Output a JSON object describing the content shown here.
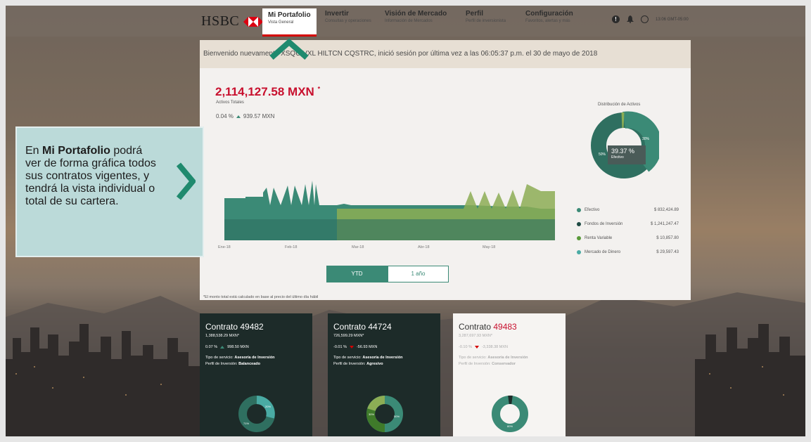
{
  "nav": {
    "logo": "HSBC",
    "items": [
      {
        "title": "Mi Portafolio",
        "sub": "Vista General"
      },
      {
        "title": "Invertir",
        "sub": "Consultas y operaciones"
      },
      {
        "title": "Visión de Mercado",
        "sub": "Información de Mercados"
      },
      {
        "title": "Perfil",
        "sub": "Perfil de inversionista"
      },
      {
        "title": "Configuración",
        "sub": "Favoritos, alertas y más"
      }
    ],
    "time": "13:06 GMT-05:00"
  },
  "welcome": "Bienvenido nuevamente XSQUIVXL HILTCN CQSTRC, inició sesión por última vez a las 06:05:37 p.m. el 30 de mayo de 2018",
  "summary": {
    "total": "2,114,127.58 MXN",
    "total_mark": "*",
    "total_label": "Activos Totales",
    "change_pct": "0.04 %",
    "change_amt": "939.57 MXN"
  },
  "chart_data": {
    "type": "area",
    "x_ticks": [
      "Ene-18",
      "Feb-18",
      "Mar-18",
      "Abr-18",
      "May-18"
    ]
  },
  "distribution": {
    "title": "Distribución de Activos",
    "tooltip_value": "39.37 %",
    "tooltip_label": "Efectivo",
    "slice_labels": [
      "30%",
      "50%"
    ],
    "legend": [
      {
        "name": "Efectivo",
        "amount": "$ 832,424.89",
        "color": "#3b8a76"
      },
      {
        "name": "Fondos de Inversión",
        "amount": "$ 1,241,247.47",
        "color": "#1e4a44"
      },
      {
        "name": "Renta Variable",
        "amount": "$ 10,857.80",
        "color": "#5a9a3a"
      },
      {
        "name": "Mercado de Dinero",
        "amount": "$ 29,597.43",
        "color": "#4aaba4"
      }
    ]
  },
  "periods": {
    "ytd": "YTD",
    "one_year": "1 año"
  },
  "footnote": "*El monto total está calculado en base al precio del último día hábil",
  "contracts": [
    {
      "label": "Contrato ",
      "number": "49482",
      "value": "1,388,538.29 MXN*",
      "pct": "0.07 %",
      "amt": "998.50 MXN",
      "service_label": "Tipo de servicio:",
      "service": "Asesoría de Inversión",
      "profile_label": "Perfil de Inversión:",
      "profile": "Balanceado"
    },
    {
      "label": "Contrato ",
      "number": "44724",
      "value": "726,599.29 MXN*",
      "pct": "-0.01 %",
      "amt": "-56.93 MXN",
      "service_label": "Tipo de servicio:",
      "service": "Asesoría de Inversión",
      "profile_label": "Perfil de Inversión:",
      "profile": "Agresivo"
    },
    {
      "label": "Contrato ",
      "number": "49483",
      "value": "3,287,697.93 MXN*",
      "pct": "-0.10 %",
      "amt": "-3,338.38 MXN",
      "service_label": "Tipo de servicio:",
      "service": "Asesoría de Inversión",
      "profile_label": "Perfil de Inversión:",
      "profile": "Conservador"
    }
  ],
  "card_donut_labels": [
    [
      "20%",
      "71%"
    ],
    [
      "30%",
      "50%"
    ],
    [
      "80%"
    ]
  ],
  "callout": {
    "pre": "En ",
    "bold": "Mi Portafolio",
    "post": " podrá ver de forma gráfica todos sus contratos vigentes, y tendrá la vista individual o total de su cartera."
  }
}
